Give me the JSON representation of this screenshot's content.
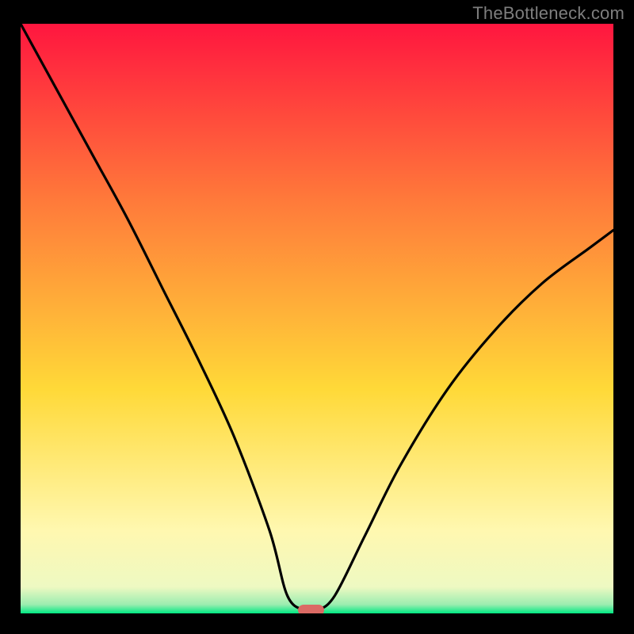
{
  "attribution": "TheBottleneck.com",
  "colors": {
    "background": "#000000",
    "gradient_top": "#ff163f",
    "gradient_mid_upper": "#ff7a3a",
    "gradient_mid": "#ffd938",
    "gradient_lower": "#fff8b0",
    "gradient_band": "#eef9c2",
    "gradient_bottom_edge": "#00e882",
    "curve": "#000000",
    "marker": "#db6a64"
  },
  "chart_data": {
    "type": "line",
    "title": "",
    "xlabel": "",
    "ylabel": "",
    "xlim": [
      0,
      100
    ],
    "ylim": [
      0,
      100
    ],
    "series": [
      {
        "name": "bottleneck-curve",
        "x": [
          0,
          6,
          12,
          18,
          24,
          30,
          36,
          42,
          45,
          48,
          50,
          53,
          58,
          64,
          72,
          80,
          88,
          96,
          100
        ],
        "y": [
          100,
          89,
          78,
          67,
          55,
          43,
          30,
          14,
          3,
          0.5,
          0.5,
          3,
          13,
          25,
          38,
          48,
          56,
          62,
          65
        ]
      }
    ],
    "marker": {
      "x": 49,
      "y": 0.5,
      "width_pct": 4.5,
      "height_pct": 1.9
    },
    "notes": "Values estimated from pixel positions; no axis ticks or labels are drawn."
  }
}
